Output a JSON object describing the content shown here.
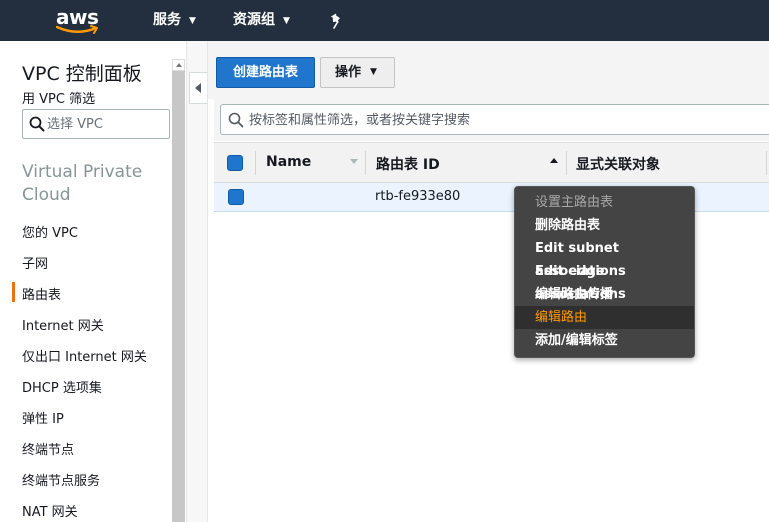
{
  "topnav": {
    "logo_text": "aws",
    "services_label": "服务",
    "resource_groups_label": "资源组"
  },
  "sidebar": {
    "title": "VPC 控制面板",
    "filter_label": "用 VPC 筛选",
    "filter_placeholder": "选择 VPC",
    "section_title": "Virtual Private Cloud",
    "items": [
      {
        "label": "您的 VPC"
      },
      {
        "label": "子网"
      },
      {
        "label": "路由表",
        "active": true
      },
      {
        "label": "Internet 网关"
      },
      {
        "label": "仅出口 Internet 网关"
      },
      {
        "label": "DHCP 选项集"
      },
      {
        "label": "弹性 IP"
      },
      {
        "label": "终端节点"
      },
      {
        "label": "终端节点服务"
      },
      {
        "label": "NAT 网关"
      }
    ]
  },
  "toolbar": {
    "create_button": "创建路由表",
    "actions_button": "操作"
  },
  "search": {
    "placeholder": "按标签和属性筛选，或者按关键字搜索"
  },
  "table": {
    "columns": [
      "Name",
      "路由表 ID",
      "显式关联对象"
    ],
    "rows": [
      {
        "name": "",
        "route_table_id": "rtb-fe933e80",
        "associations": "",
        "selected": true
      }
    ]
  },
  "context_menu": {
    "items": [
      {
        "label": "设置主路由表",
        "state": "disabled"
      },
      {
        "label": "删除路由表",
        "state": "enabled"
      },
      {
        "label": "Edit subnet associations",
        "state": "enabled"
      },
      {
        "label": "Edit edge associations",
        "state": "enabled"
      },
      {
        "label": "编辑路由传播",
        "state": "enabled"
      },
      {
        "label": "编辑路由",
        "state": "highlighted"
      },
      {
        "label": "添加/编辑标签",
        "state": "enabled"
      }
    ]
  },
  "colors": {
    "nav_bg": "#232f3e",
    "primary_button": "#1f76cc",
    "active_accent": "#ec7211",
    "menu_highlight": "#ff9900",
    "menu_bg": "#444444"
  },
  "icons": [
    "aws-logo",
    "pin-icon",
    "search-icon",
    "collapse-arrow-icon",
    "chevron-down-icon",
    "sort-icon"
  ]
}
